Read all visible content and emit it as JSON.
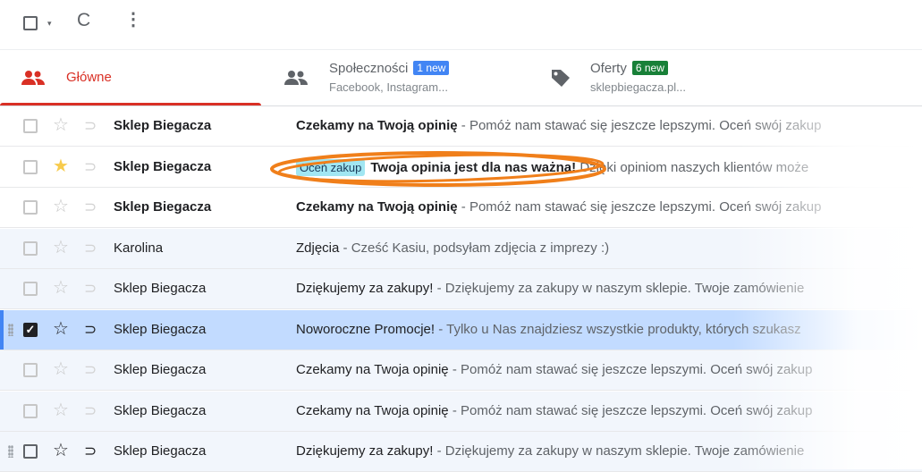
{
  "toolbar": {
    "select_caret": "▾",
    "refresh": "C",
    "more": "⋮"
  },
  "tabs": {
    "main": {
      "label": "Główne",
      "icon": "people-icon",
      "color": "#d93025"
    },
    "social": {
      "title": "Społeczności",
      "badge": "1 new",
      "badge_color": "#4285f4",
      "sub": "Facebook, Instagram...",
      "icon": "people-icon"
    },
    "offers": {
      "title": "Oferty",
      "badge": "6 new",
      "badge_color": "#188038",
      "sub": "sklepbiegacza.pl...",
      "icon": "tag-icon"
    }
  },
  "emails": [
    {
      "sender": "Sklep Biegacza",
      "subject": "Czekamy na Twoją opinię",
      "snippet": " - Pomóż nam stawać się jeszcze lepszymi. Oceń swój zakup",
      "unread": true,
      "starred": false,
      "checked": false
    },
    {
      "sender": "Sklep Biegacza",
      "label": "Oceń zakup",
      "subject": "Twoja opinia jest dla nas ważna!",
      "snippet": " Dzięki opiniom naszych klientów może",
      "unread": true,
      "starred": true,
      "checked": false,
      "highlighted": true
    },
    {
      "sender": "Sklep Biegacza",
      "subject": "Czekamy na Twoją opinię",
      "snippet": " - Pomóż nam stawać się jeszcze lepszymi. Oceń swój zakup",
      "unread": true,
      "starred": false,
      "checked": false
    },
    {
      "sender": "Karolina",
      "subject": "Zdjęcia",
      "snippet": " - Cześć Kasiu, podsyłam zdjęcia z imprezy :)",
      "unread": false,
      "starred": false,
      "checked": false
    },
    {
      "sender": "Sklep Biegacza",
      "subject": "Dziękujemy za zakupy!",
      "snippet": " - Dziękujemy za zakupy w naszym sklepie. Twoje zamówienie",
      "unread": false,
      "starred": false,
      "checked": false
    },
    {
      "sender": "Sklep Biegacza",
      "subject": "Noworoczne Promocje!",
      "snippet": " - Tylko u Nas znajdziesz wszystkie produkty, których szukasz",
      "unread": false,
      "starred": false,
      "checked": true
    },
    {
      "sender": "Sklep Biegacza",
      "subject": "Czekamy na Twoja opinię",
      "snippet": " - Pomóż nam stawać się jeszcze lepszymi. Oceń swój zakup",
      "unread": false,
      "starred": false,
      "checked": false
    },
    {
      "sender": "Sklep Biegacza",
      "subject": "Czekamy na Twoja opinię",
      "snippet": " - Pomóż nam stawać się jeszcze lepszymi. Oceń swój zakup",
      "unread": false,
      "starred": false,
      "checked": false
    },
    {
      "sender": "Sklep Biegacza",
      "subject": "Dziękujemy za zakupy!",
      "snippet": " - Dziękujemy za zakupy w naszym sklepie. Twoje zamówienie",
      "unread": false,
      "starred": false,
      "checked": false
    }
  ],
  "colors": {
    "accent": "#d93025",
    "selected_row": "#c2dbff",
    "read_row": "#f2f6fc",
    "highlight_ring": "#f07f1a",
    "label_chip": "#a1e6f2",
    "star": "#f7cb4d"
  }
}
